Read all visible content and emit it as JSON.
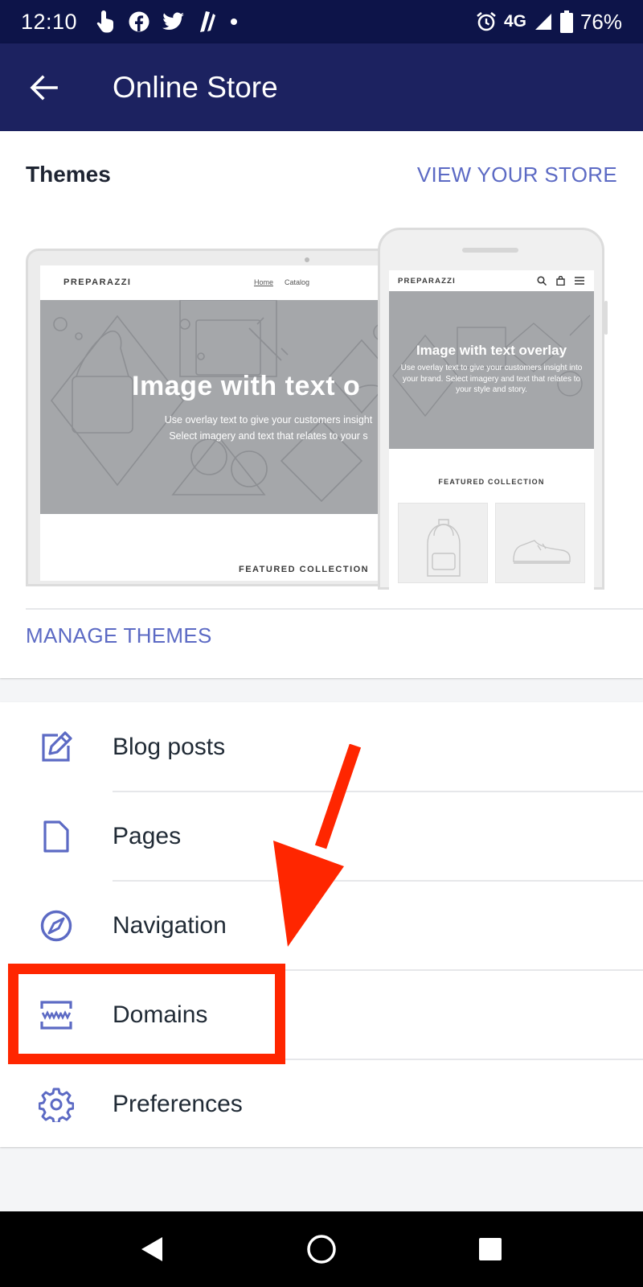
{
  "status_bar": {
    "time": "12:10",
    "network": "4G",
    "battery": "76%",
    "icons": [
      "touch-icon",
      "facebook-icon",
      "twitter-icon",
      "notification-icon",
      "dot-icon",
      "alarm-icon",
      "signal-icon",
      "battery-icon"
    ]
  },
  "app_bar": {
    "title": "Online Store",
    "back_icon": "arrow-left-icon"
  },
  "themes": {
    "title": "Themes",
    "view_store_label": "VIEW YOUR STORE",
    "manage_label": "MANAGE THEMES",
    "preview": {
      "brand": "PREPARAZZI",
      "nav_links": [
        "Home",
        "Catalog"
      ],
      "desktop_hero_title": "Image with text o",
      "desktop_hero_line1": "Use overlay text to give your customers insight",
      "desktop_hero_line2": "Select imagery and text that relates to your s",
      "mobile_hero_title": "Image with text overlay",
      "mobile_hero_sub": "Use overlay text to give your customers insight into your brand. Select imagery and text that relates to your style and story.",
      "featured": "FEATURED COLLECTION"
    }
  },
  "menu": {
    "items": [
      {
        "label": "Blog posts",
        "icon": "edit-icon"
      },
      {
        "label": "Pages",
        "icon": "page-icon"
      },
      {
        "label": "Navigation",
        "icon": "compass-icon"
      },
      {
        "label": "Domains",
        "icon": "domain-icon"
      },
      {
        "label": "Preferences",
        "icon": "gear-icon"
      }
    ]
  },
  "annotation": {
    "highlighted_item": "Domains",
    "color": "#ff2600"
  },
  "colors": {
    "status_bar": "#0d1449",
    "app_bar": "#1c2260",
    "accent": "#5c6ac4",
    "annotation": "#ff2600"
  },
  "nav_bar": {
    "icons": [
      "back-triangle-icon",
      "home-circle-icon",
      "recents-square-icon"
    ]
  }
}
